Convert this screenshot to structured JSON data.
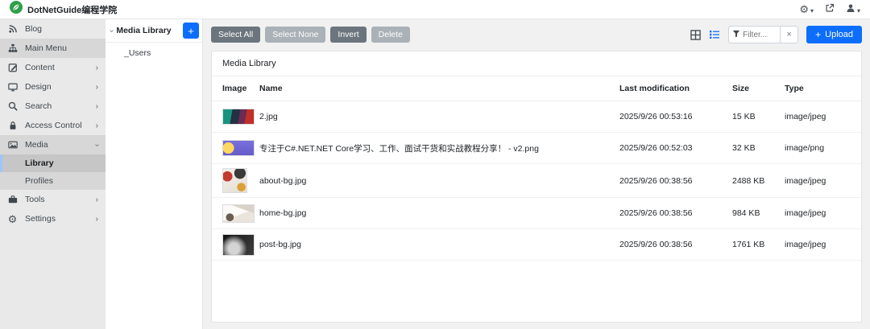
{
  "topbar": {
    "brand": "DotNetGuide编程学院"
  },
  "sidebar": {
    "items": [
      {
        "label": "Blog"
      },
      {
        "label": "Main Menu"
      },
      {
        "label": "Content"
      },
      {
        "label": "Design"
      },
      {
        "label": "Search"
      },
      {
        "label": "Access Control"
      },
      {
        "label": "Media"
      },
      {
        "label": "Library"
      },
      {
        "label": "Profiles"
      },
      {
        "label": "Tools"
      },
      {
        "label": "Settings"
      }
    ]
  },
  "tree": {
    "root_label": "Media Library",
    "children": [
      {
        "label": "_Users"
      }
    ]
  },
  "toolbar": {
    "select_all": "Select All",
    "select_none": "Select None",
    "invert": "Invert",
    "delete": "Delete",
    "filter_placeholder": "Filter...",
    "upload_label": "Upload"
  },
  "card": {
    "title": "Media Library"
  },
  "table": {
    "headers": [
      "Image",
      "Name",
      "Last modification",
      "Size",
      "Type"
    ],
    "rows": [
      {
        "name": "2.jpg",
        "modified": "2025/9/26 00:53:16",
        "size": "15 KB",
        "type": "image/jpeg"
      },
      {
        "name": "专注于C#.NET.NET Core学习、工作、面试干货和实战教程分享！ - v2.png",
        "modified": "2025/9/26 00:52:03",
        "size": "32 KB",
        "type": "image/png"
      },
      {
        "name": "about-bg.jpg",
        "modified": "2025/9/26 00:38:56",
        "size": "2488 KB",
        "type": "image/jpeg"
      },
      {
        "name": "home-bg.jpg",
        "modified": "2025/9/26 00:38:56",
        "size": "984 KB",
        "type": "image/jpeg"
      },
      {
        "name": "post-bg.jpg",
        "modified": "2025/9/26 00:38:56",
        "size": "1761 KB",
        "type": "image/jpeg"
      }
    ]
  },
  "icons": {
    "settings": "gear",
    "external": "arrow-up-right-square",
    "user": "person",
    "grid_view": "grid",
    "list_view": "list-bullets",
    "filter": "funnel",
    "add": "plus",
    "clear": "x"
  },
  "colors": {
    "primary": "#0d6efd",
    "secondary": "#6c757d",
    "secondary_disabled": "#aab1b7",
    "brand_green": "#2f9e49",
    "active_accent": "#9ec5fe"
  }
}
